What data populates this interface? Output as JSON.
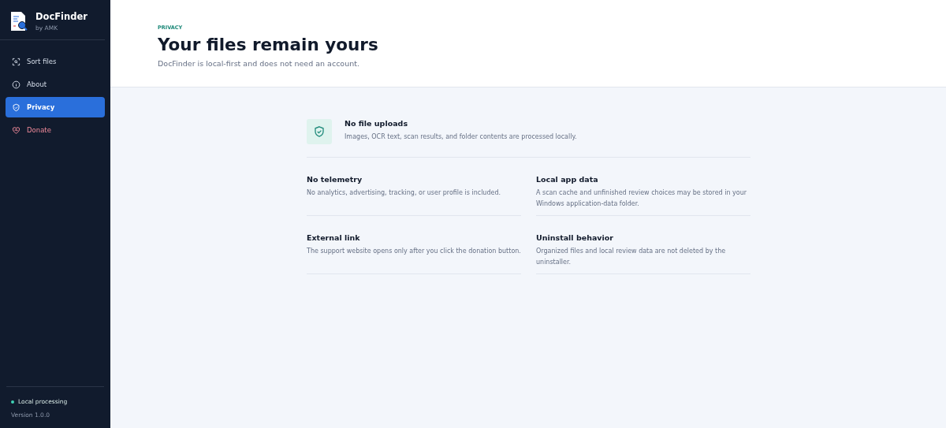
{
  "app": {
    "name": "DocFinder",
    "byline": "by AMK"
  },
  "nav": [
    {
      "label": "Sort files",
      "kind": "scan",
      "selected": false
    },
    {
      "label": "About",
      "kind": "info",
      "selected": false
    },
    {
      "label": "Privacy",
      "kind": "shield",
      "selected": true
    },
    {
      "label": "Donate",
      "kind": "heart",
      "selected": false
    }
  ],
  "footer": {
    "status": "Local processing",
    "version": "Version 1.0.0"
  },
  "header": {
    "eyebrow": "PRIVACY",
    "title": "Your files remain yours",
    "subtitle": "DocFinder is local-first and does not need an account."
  },
  "featured": {
    "title": "No file uploads",
    "text": "Images, OCR text, scan results, and folder contents are processed locally."
  },
  "items": [
    {
      "title": "No telemetry",
      "text": "No analytics, advertising, tracking, or user profile is included."
    },
    {
      "title": "Local app data",
      "text": "A scan cache and unfinished review choices may be stored in your Windows application-data folder."
    },
    {
      "title": "External link",
      "text": "The support website opens only after you click the donation button."
    },
    {
      "title": "Uninstall behavior",
      "text": "Organized files and local review data are not deleted by the uninstaller."
    }
  ]
}
